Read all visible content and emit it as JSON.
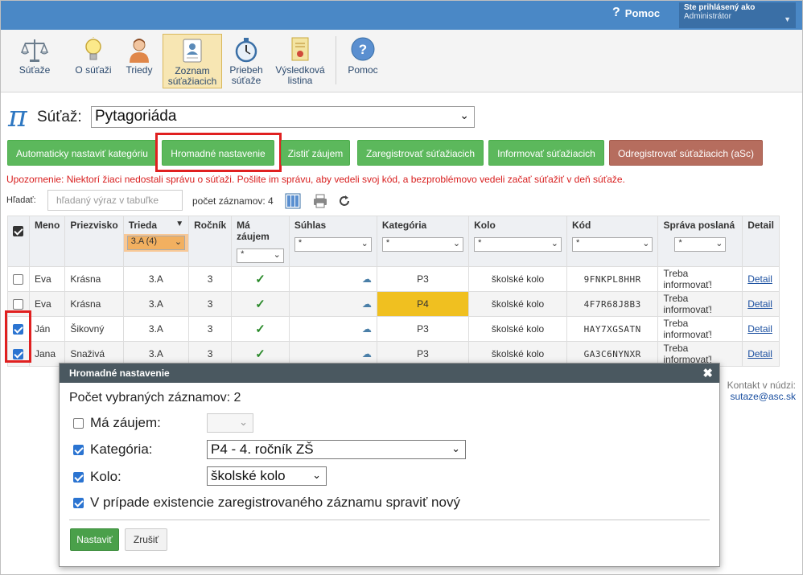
{
  "header": {
    "help_label": "Pomoc",
    "login_line1": "Ste prihlásený ako",
    "login_line2": "Administrátor"
  },
  "toolbar": {
    "items": [
      {
        "label": "Súťaže",
        "icon": "scales-icon"
      },
      {
        "label": "O súťaži",
        "icon": "lightbulb-icon"
      },
      {
        "label": "Triedy",
        "icon": "person-icon"
      },
      {
        "label": "Zoznam súťažiacich",
        "icon": "id-card-icon"
      },
      {
        "label": "Priebeh súťaže",
        "icon": "stopwatch-icon"
      },
      {
        "label": "Výsledková listina",
        "icon": "certificate-icon"
      },
      {
        "label": "Pomoc",
        "icon": "help-icon"
      }
    ]
  },
  "competition": {
    "label": "Súťaž:",
    "value": "Pytagoriáda"
  },
  "actions": {
    "auto_category": "Automaticky nastaviť kategóriu",
    "bulk_settings": "Hromadné nastavenie",
    "find_interest": "Zistiť záujem",
    "register": "Zaregistrovať súťažiacich",
    "inform": "Informovať súťažiacich",
    "unregister": "Odregistrovať súťažiacich (aSc)"
  },
  "warning": "Upozornenie: Niektorí žiaci nedostali správu o súťaži. Pošlite im správu, aby vedeli svoj kód, a bezproblémovo vedeli začať súťažiť v deň súťaže.",
  "search": {
    "label": "Hľadať:",
    "placeholder": "hľadaný výraz v tabuľke",
    "count_text": "počet záznamov: 4"
  },
  "table": {
    "headers": {
      "meno": "Meno",
      "priezvisko": "Priezvisko",
      "trieda": "Trieda",
      "rocnik": "Ročník",
      "zaujem": "Má záujem",
      "suhlas": "Súhlas",
      "kategoria": "Kategória",
      "kolo": "Kolo",
      "kod": "Kód",
      "sprava": "Správa poslaná",
      "detail": "Detail"
    },
    "filters": {
      "trieda": "3.A (4)",
      "star": "*"
    },
    "rows": [
      {
        "meno": "Eva",
        "priezvisko": "Krásna",
        "trieda": "3.A",
        "rocnik": "3",
        "kategoria": "P3",
        "kolo": "školské kolo",
        "kod": "9FNKPL8HHR",
        "sprava": "Treba informovať!",
        "detail": "Detail",
        "checked": false
      },
      {
        "meno": "Eva",
        "priezvisko": "Krásna",
        "trieda": "3.A",
        "rocnik": "3",
        "kategoria": "P4",
        "kolo": "školské kolo",
        "kod": "4F7R68J8B3",
        "sprava": "Treba informovať!",
        "detail": "Detail",
        "checked": false
      },
      {
        "meno": "Ján",
        "priezvisko": "Šikovný",
        "trieda": "3.A",
        "rocnik": "3",
        "kategoria": "P3",
        "kolo": "školské kolo",
        "kod": "HAY7XGSATN",
        "sprava": "Treba informovať!",
        "detail": "Detail",
        "checked": true
      },
      {
        "meno": "Jana",
        "priezvisko": "Snaživá",
        "trieda": "3.A",
        "rocnik": "3",
        "kategoria": "P3",
        "kolo": "školské kolo",
        "kod": "GA3C6NYNXR",
        "sprava": "Treba informovať!",
        "detail": "Detail",
        "checked": true
      }
    ]
  },
  "contact": {
    "line1": "Kontakt v núdzi:",
    "email": "sutaze@asc.sk"
  },
  "modal": {
    "title": "Hromadné nastavenie",
    "count": "Počet vybraných záznamov: 2",
    "zaujem_label": "Má záujem:",
    "kategoria_label": "Kategória:",
    "kategoria_value": "P4 - 4. ročník ZŠ",
    "kolo_label": "Kolo:",
    "kolo_value": "školské kolo",
    "new_record_label": "V prípade existencie zaregistrovaného záznamu spraviť nový",
    "ok": "Nastaviť",
    "cancel": "Zrušiť"
  },
  "colors": {
    "accent": "#4a88c6",
    "green": "#5cb85c",
    "red_button": "#b66d5e",
    "highlight": "#e02020",
    "warning_text": "#d81e1e",
    "category_highlight": "#f0c020"
  }
}
